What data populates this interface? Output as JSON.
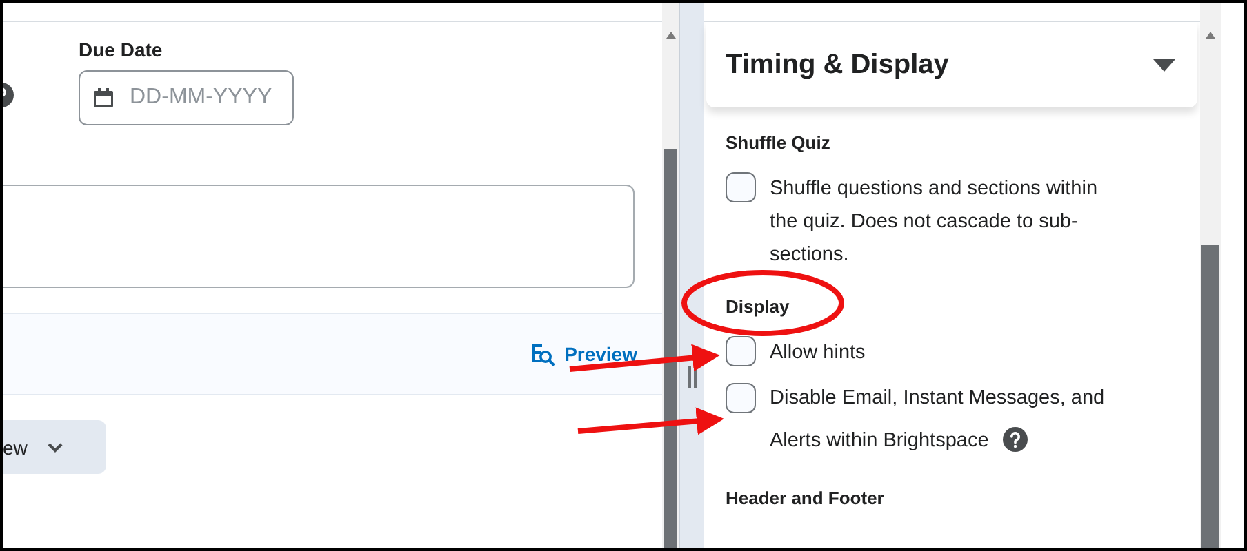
{
  "due_date": {
    "label": "Due Date",
    "placeholder": "DD-MM-YYYY"
  },
  "toolbar": {
    "preview_link": "Preview"
  },
  "dropdown_button": {
    "label": "ew"
  },
  "panel": {
    "title": "Timing & Display"
  },
  "sections": [
    {
      "heading": "Shuffle Quiz",
      "options": [
        {
          "label": "Shuffle questions and sections within the quiz. Does not cascade to sub-sections.",
          "checked": false,
          "help": false
        }
      ]
    },
    {
      "heading": "Display",
      "options": [
        {
          "label": "Allow hints",
          "checked": false,
          "help": false
        },
        {
          "label": "Disable Email, Instant Messages, and Alerts within Brightspace",
          "checked": false,
          "help": true
        }
      ]
    },
    {
      "heading": "Header and Footer"
    }
  ]
}
